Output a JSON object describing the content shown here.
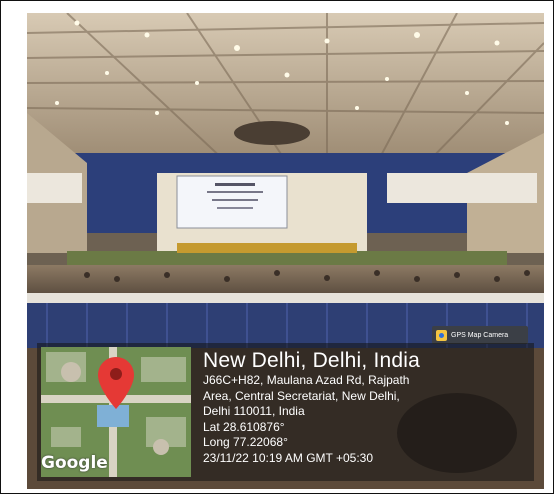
{
  "camera_badge": {
    "label": "GPS Map Camera",
    "icon": "camera-icon"
  },
  "location": {
    "title": "New Delhi, Delhi, India",
    "address_lines": [
      "J66C+H82, Maulana Azad Rd, Rajpath",
      "Area, Central Secretariat, New Delhi,",
      "Delhi 110011, India"
    ],
    "lat": "Lat 28.610876°",
    "long": "Long 77.22068°",
    "timestamp": "23/11/22 10:19 AM GMT +05:30"
  },
  "map": {
    "provider": "Google",
    "pin_icon": "map-pin-icon",
    "pin_color": "#e53935"
  },
  "colors": {
    "overlay": "#1c1c1c",
    "stage_blue": "#2c3f7a",
    "ceiling": "#c9b9a2"
  }
}
